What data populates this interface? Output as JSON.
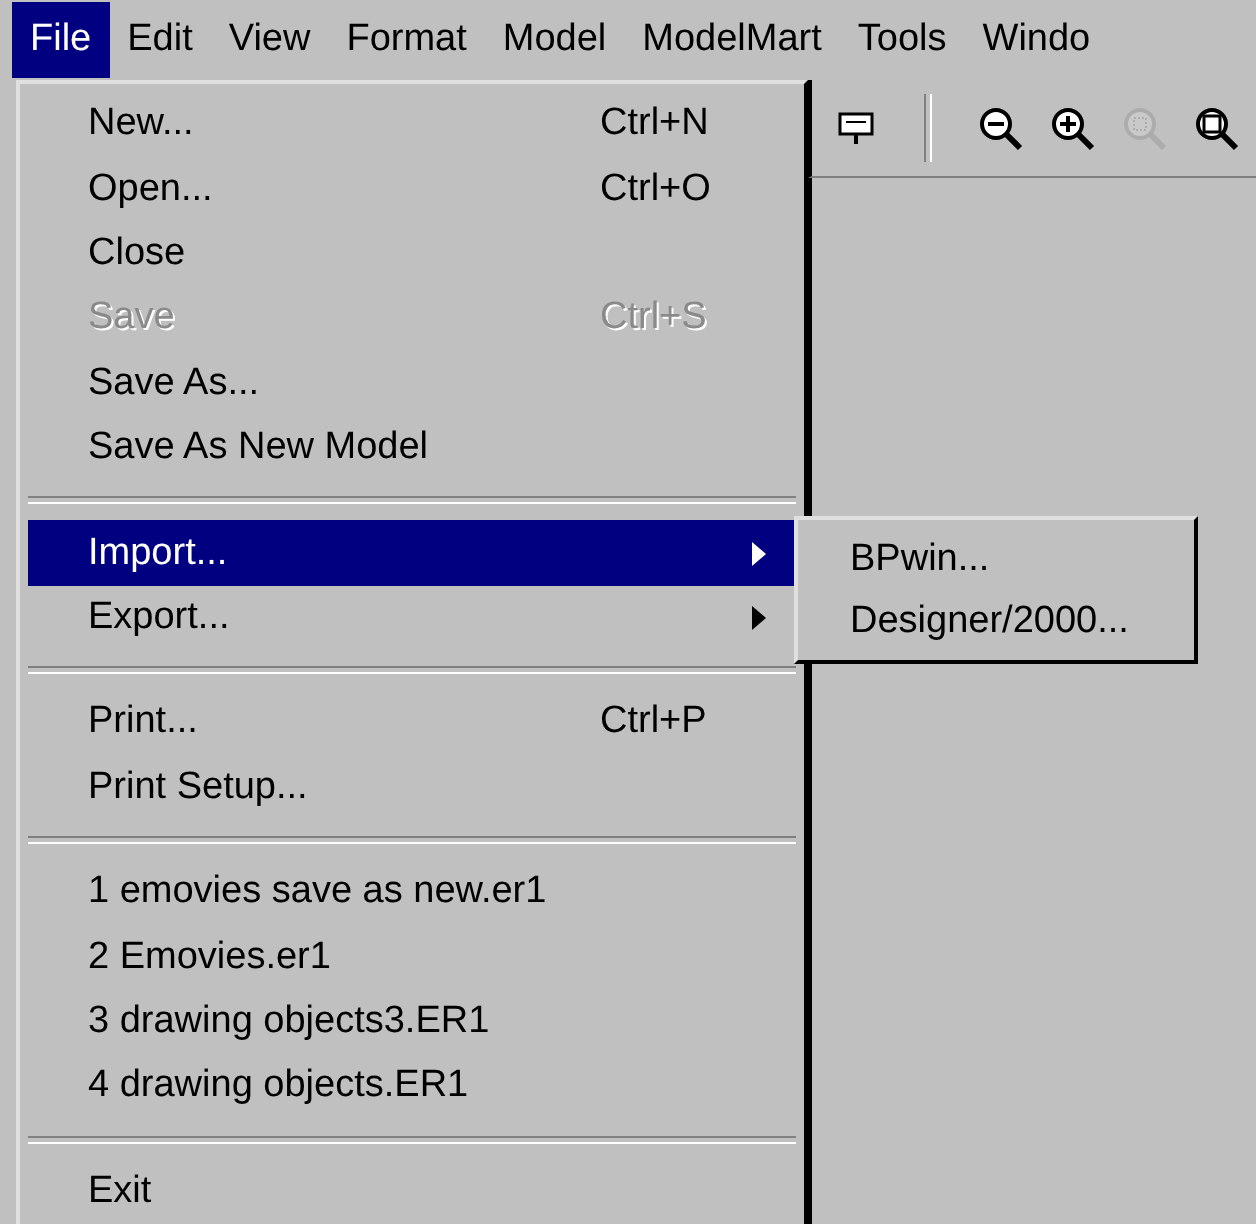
{
  "menu_bar": [
    {
      "label": "File",
      "selected": true
    },
    {
      "label": "Edit",
      "selected": false
    },
    {
      "label": "View",
      "selected": false
    },
    {
      "label": "Format",
      "selected": false
    },
    {
      "label": "Model",
      "selected": false
    },
    {
      "label": "ModelMart",
      "selected": false
    },
    {
      "label": "Tools",
      "selected": false
    },
    {
      "label": "Windo",
      "selected": false
    }
  ],
  "toolbar": [
    {
      "kind": "note",
      "disabled": false
    },
    {
      "kind": "separator"
    },
    {
      "kind": "zoom-out",
      "disabled": false
    },
    {
      "kind": "zoom-in",
      "disabled": false
    },
    {
      "kind": "zoom-area",
      "disabled": true
    },
    {
      "kind": "zoom-fit",
      "disabled": false
    }
  ],
  "file_menu": [
    {
      "kind": "item",
      "label": "New...",
      "shortcut": "Ctrl+N",
      "disabled": false,
      "selected": false
    },
    {
      "kind": "item",
      "label": "Open...",
      "shortcut": "Ctrl+O",
      "disabled": false,
      "selected": false
    },
    {
      "kind": "item",
      "label": "Close",
      "disabled": false,
      "selected": false
    },
    {
      "kind": "item",
      "label": "Save",
      "shortcut": "Ctrl+S",
      "disabled": true,
      "selected": false
    },
    {
      "kind": "item",
      "label": "Save As...",
      "disabled": false,
      "selected": false
    },
    {
      "kind": "item",
      "label": "Save As New Model",
      "disabled": false,
      "selected": false
    },
    {
      "kind": "separator"
    },
    {
      "kind": "submenu",
      "label": "Import...",
      "disabled": false,
      "selected": true,
      "children": [
        {
          "label": "BPwin..."
        },
        {
          "label": "Designer/2000..."
        }
      ]
    },
    {
      "kind": "submenu",
      "label": "Export...",
      "disabled": false,
      "selected": false
    },
    {
      "kind": "separator"
    },
    {
      "kind": "item",
      "label": "Print...",
      "shortcut": "Ctrl+P",
      "disabled": false,
      "selected": false
    },
    {
      "kind": "item",
      "label": "Print Setup...",
      "disabled": false,
      "selected": false
    },
    {
      "kind": "separator"
    },
    {
      "kind": "item",
      "label": "1 emovies save as new.er1",
      "disabled": false,
      "selected": false
    },
    {
      "kind": "item",
      "label": "2 Emovies.er1",
      "disabled": false,
      "selected": false
    },
    {
      "kind": "item",
      "label": "3 drawing objects3.ER1",
      "disabled": false,
      "selected": false
    },
    {
      "kind": "item",
      "label": "4 drawing objects.ER1",
      "disabled": false,
      "selected": false
    },
    {
      "kind": "separator"
    },
    {
      "kind": "item",
      "label": "Exit",
      "disabled": false,
      "selected": false
    }
  ]
}
